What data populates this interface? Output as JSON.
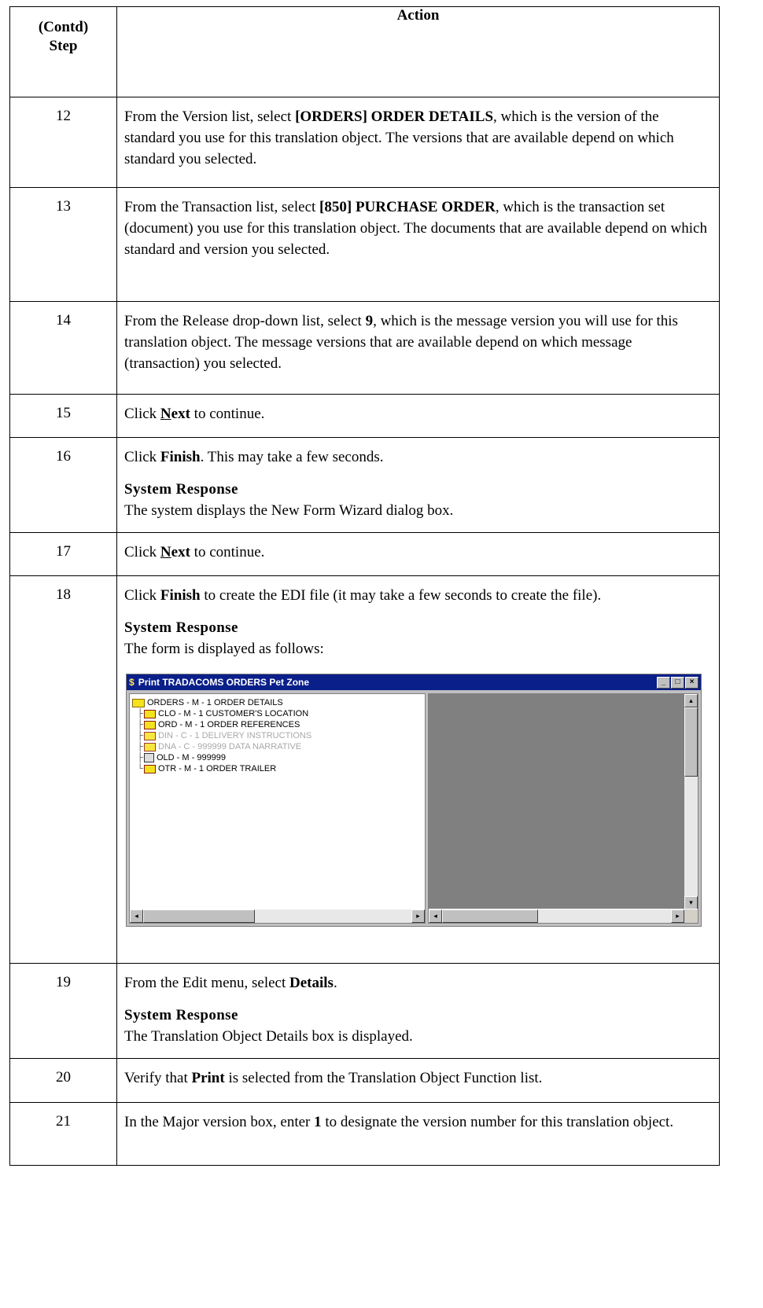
{
  "header": {
    "step_line1": "(Contd)",
    "step_line2": "Step",
    "action": "Action"
  },
  "rows": [
    {
      "num": "12",
      "parts": [
        {
          "t": "From the Version list, select "
        },
        {
          "b": "[ORDERS] ORDER DETAILS"
        },
        {
          "t": ", which is the version of the standard you use for this translation object. The versions that are available depend on which standard you selected."
        }
      ]
    },
    {
      "num": "13",
      "parts": [
        {
          "t": "From the Transaction list, select "
        },
        {
          "b": "[850] PURCHASE ORDER"
        },
        {
          "t": ", which is the transaction set (document) you use for this translation object. The documents that are available depend on which standard and version you selected."
        }
      ]
    },
    {
      "num": "14",
      "parts": [
        {
          "t": "From the Release drop-down list, select "
        },
        {
          "b": "9"
        },
        {
          "t": ", which is the message version you will use for this translation object. The message versions that are available depend on which message (transaction) you selected."
        }
      ]
    },
    {
      "num": "15",
      "parts": [
        {
          "t": "Click "
        },
        {
          "bu": "N"
        },
        {
          "b": "ext"
        },
        {
          "t": " to continue."
        }
      ]
    },
    {
      "num": "16",
      "parts": [
        {
          "t": "Click "
        },
        {
          "b": "Finish"
        },
        {
          "t": ". This may take a few seconds."
        }
      ],
      "sr_title": "System Response",
      "sr_text": "The system displays the New Form Wizard dialog box."
    },
    {
      "num": "17",
      "parts": [
        {
          "t": "Click "
        },
        {
          "bu": "N"
        },
        {
          "b": "ext"
        },
        {
          "t": " to continue."
        }
      ]
    },
    {
      "num": "18",
      "parts": [
        {
          "t": "Click "
        },
        {
          "b": "Finish"
        },
        {
          "t": " to create the EDI file (it may take a few seconds to create the file)."
        }
      ],
      "sr_title": "System Response",
      "sr_text": "The form is displayed as follows:"
    },
    {
      "num": "19",
      "parts": [
        {
          "t": "From the Edit menu, select "
        },
        {
          "b": "Details"
        },
        {
          "t": "."
        }
      ],
      "sr_title": "System Response",
      "sr_text": "The Translation Object Details box is displayed."
    },
    {
      "num": "20",
      "parts": [
        {
          "t": "Verify that "
        },
        {
          "b": "Print"
        },
        {
          "t": " is selected from the Translation Object Function list."
        }
      ]
    },
    {
      "num": "21",
      "parts": [
        {
          "t": "In the Major version box, enter "
        },
        {
          "b": "1"
        },
        {
          "t": " to designate the version number for this translation object."
        }
      ]
    }
  ],
  "window": {
    "title": "Print TRADACOMS ORDERS Pet Zone",
    "app_icon": "app-icon",
    "tree": {
      "root": "ORDERS - M - 1 ORDER DETAILS",
      "items": [
        {
          "label": "CLO - M - 1 CUSTOMER'S LOCATION",
          "icon": "segment-icon",
          "dim": false
        },
        {
          "label": "ORD - M - 1 ORDER REFERENCES",
          "icon": "segment-icon",
          "dim": false
        },
        {
          "label": "DIN - C - 1 DELIVERY INSTRUCTIONS",
          "icon": "segment-icon",
          "dim": true
        },
        {
          "label": "DNA - C - 999999 DATA NARRATIVE",
          "icon": "segment-icon",
          "dim": true
        },
        {
          "label": "OLD - M - 999999",
          "icon": "loop-icon",
          "dim": false
        },
        {
          "label": "OTR - M - 1 ORDER TRAILER",
          "icon": "segment-icon",
          "dim": false
        }
      ]
    }
  }
}
